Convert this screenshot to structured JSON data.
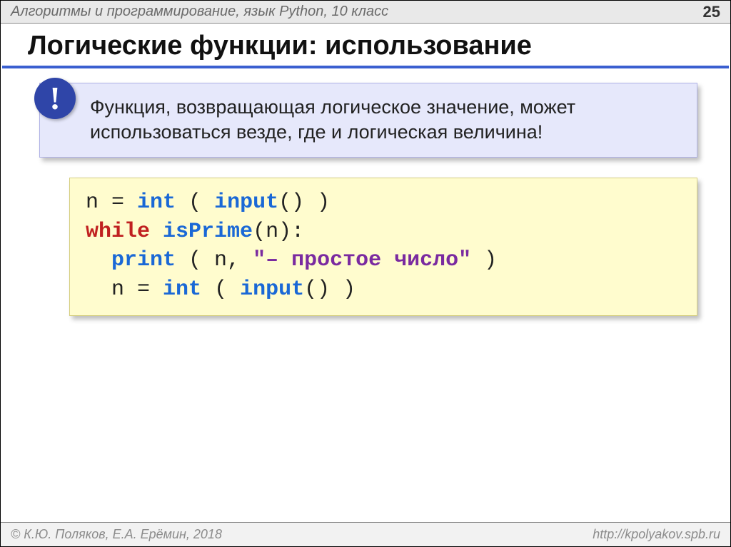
{
  "header": {
    "subject": "Алгоритмы и программирование, язык Python, 10 класс",
    "page_number": "25"
  },
  "title": "Логические функции: использование",
  "callout": {
    "badge": "!",
    "text": "Функция, возвращающая логическое значение, может использоваться везде, где и логическая величина!"
  },
  "code": {
    "line1": {
      "var": "n",
      "eq": " = ",
      "int": "int",
      "lp": " ( ",
      "input": "input",
      "rp": "() )"
    },
    "line2": {
      "while": "while",
      "sp": " ",
      "fn": "isPrime",
      "args": "(n):"
    },
    "line3": {
      "indent": "  ",
      "print": "print",
      "lp": " ( n, ",
      "str": "\"– простое число\"",
      "rp": " ) "
    },
    "line4": {
      "indent": "  ",
      "var": "n",
      "eq": " = ",
      "int": "int",
      "lp": " ( ",
      "input": "input",
      "rp": "() )"
    }
  },
  "footer": {
    "copyright": "© К.Ю. Поляков, Е.А. Ерёмин, 2018",
    "url": "http://kpolyakov.spb.ru"
  }
}
